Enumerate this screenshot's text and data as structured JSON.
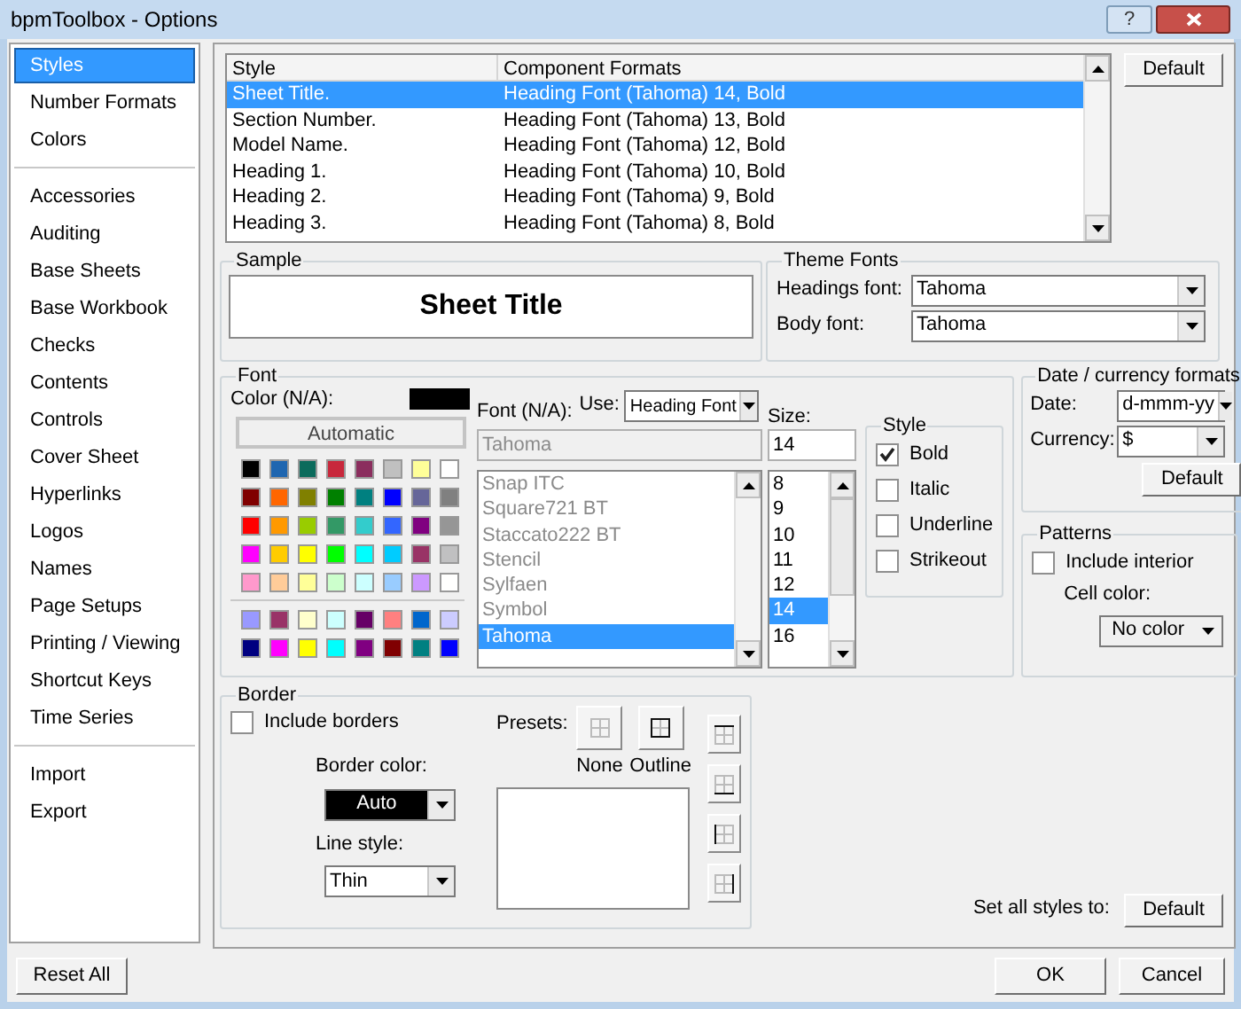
{
  "window": {
    "title": "bpmToolbox - Options",
    "help_button": "?"
  },
  "sidebar": {
    "groups": [
      {
        "items": [
          {
            "label": "Styles",
            "selected": true
          },
          {
            "label": "Number Formats",
            "selected": false
          },
          {
            "label": "Colors",
            "selected": false
          }
        ]
      },
      {
        "items": [
          {
            "label": "Accessories",
            "selected": false
          },
          {
            "label": "Auditing",
            "selected": false
          },
          {
            "label": "Base Sheets",
            "selected": false
          },
          {
            "label": "Base Workbook",
            "selected": false
          },
          {
            "label": "Checks",
            "selected": false
          },
          {
            "label": "Contents",
            "selected": false
          },
          {
            "label": "Controls",
            "selected": false
          },
          {
            "label": "Cover Sheet",
            "selected": false
          },
          {
            "label": "Hyperlinks",
            "selected": false
          },
          {
            "label": "Logos",
            "selected": false
          },
          {
            "label": "Names",
            "selected": false
          },
          {
            "label": "Page Setups",
            "selected": false
          },
          {
            "label": "Printing / Viewing",
            "selected": false
          },
          {
            "label": "Shortcut Keys",
            "selected": false
          },
          {
            "label": "Time Series",
            "selected": false
          }
        ]
      },
      {
        "items": [
          {
            "label": "Import",
            "selected": false
          },
          {
            "label": "Export",
            "selected": false
          }
        ]
      }
    ]
  },
  "styles_table": {
    "columns": [
      "Style",
      "Component Formats"
    ],
    "rows": [
      {
        "style": "Sheet Title.",
        "formats": "Heading Font (Tahoma) 14, Bold",
        "selected": true
      },
      {
        "style": "Section Number.",
        "formats": "Heading Font (Tahoma) 13, Bold",
        "selected": false
      },
      {
        "style": "Model Name.",
        "formats": "Heading Font (Tahoma) 12, Bold",
        "selected": false
      },
      {
        "style": "Heading 1.",
        "formats": "Heading Font (Tahoma) 10, Bold",
        "selected": false
      },
      {
        "style": "Heading 2.",
        "formats": "Heading Font (Tahoma) 9, Bold",
        "selected": false
      },
      {
        "style": "Heading 3.",
        "formats": "Heading Font (Tahoma) 8, Bold",
        "selected": false
      }
    ]
  },
  "default_button": "Default",
  "sample": {
    "title": "Sample",
    "text": "Sheet Title"
  },
  "theme_fonts": {
    "title": "Theme Fonts",
    "fields": [
      {
        "label": "Headings font:",
        "value": "Tahoma"
      },
      {
        "label": "Body font:",
        "value": "Tahoma"
      }
    ]
  },
  "font": {
    "title": "Font",
    "color_label": "Color (N/A):",
    "color_swatch": {
      "color": "#000000"
    },
    "automatic_button": "Automatic",
    "palette": [
      {
        "color": "#000000"
      },
      {
        "color": "#1f66b0"
      },
      {
        "color": "#0b6b5c"
      },
      {
        "color": "#c8283c"
      },
      {
        "color": "#8b2e5e"
      },
      {
        "color": "#c0c0c0"
      },
      {
        "color": "#ffff99"
      },
      {
        "color": "#ffffff"
      },
      {
        "color": "#800000"
      },
      {
        "color": "#ff6600"
      },
      {
        "color": "#808000"
      },
      {
        "color": "#008000"
      },
      {
        "color": "#008080"
      },
      {
        "color": "#0000ff"
      },
      {
        "color": "#666699"
      },
      {
        "color": "#808080"
      },
      {
        "color": "#ff0000"
      },
      {
        "color": "#ff9900"
      },
      {
        "color": "#99cc00"
      },
      {
        "color": "#339966"
      },
      {
        "color": "#33cccc"
      },
      {
        "color": "#3366ff"
      },
      {
        "color": "#800080"
      },
      {
        "color": "#969696"
      },
      {
        "color": "#ff00ff"
      },
      {
        "color": "#ffcc00"
      },
      {
        "color": "#ffff00"
      },
      {
        "color": "#00ff00"
      },
      {
        "color": "#00ffff"
      },
      {
        "color": "#00ccff"
      },
      {
        "color": "#993366"
      },
      {
        "color": "#c0c0c1"
      },
      {
        "color": "#ff99cc"
      },
      {
        "color": "#ffcc99"
      },
      {
        "color": "#ffff98"
      },
      {
        "color": "#ccffcc"
      },
      {
        "color": "#ccffff"
      },
      {
        "color": "#99ccff"
      },
      {
        "color": "#cc99ff"
      },
      {
        "color": "#fffffe"
      }
    ],
    "extra_palette": [
      {
        "color": "#9999ff"
      },
      {
        "color": "#993367"
      },
      {
        "color": "#ffffcc"
      },
      {
        "color": "#ccfffe"
      },
      {
        "color": "#660066"
      },
      {
        "color": "#ff8080"
      },
      {
        "color": "#0066cc"
      },
      {
        "color": "#ccccff"
      },
      {
        "color": "#000080"
      },
      {
        "color": "#ff00fe"
      },
      {
        "color": "#ffff01"
      },
      {
        "color": "#00fffe"
      },
      {
        "color": "#800081"
      },
      {
        "color": "#800001"
      },
      {
        "color": "#008081"
      },
      {
        "color": "#0000fe"
      }
    ],
    "font_label": "Font (N/A):",
    "use_label": "Use:",
    "use_value": "Heading Font",
    "size_label": "Size:",
    "font_name": "Tahoma",
    "size_value": "14",
    "fonts": [
      {
        "name": "Snap ITC",
        "selected": false
      },
      {
        "name": "Square721 BT",
        "selected": false
      },
      {
        "name": "Staccato222 BT",
        "selected": false
      },
      {
        "name": "Stencil",
        "selected": false
      },
      {
        "name": "Sylfaen",
        "selected": false
      },
      {
        "name": "Symbol",
        "selected": false
      },
      {
        "name": "Tahoma",
        "selected": true
      }
    ],
    "sizes": [
      {
        "value": "8",
        "selected": false
      },
      {
        "value": "9",
        "selected": false
      },
      {
        "value": "10",
        "selected": false
      },
      {
        "value": "11",
        "selected": false
      },
      {
        "value": "12",
        "selected": false
      },
      {
        "value": "14",
        "selected": true
      },
      {
        "value": "16",
        "selected": false
      }
    ],
    "style": {
      "title": "Style",
      "options": [
        {
          "label": "Bold",
          "checked": true
        },
        {
          "label": "Italic",
          "checked": false
        },
        {
          "label": "Underline",
          "checked": false
        },
        {
          "label": "Strikeout",
          "checked": false
        }
      ]
    }
  },
  "date_currency": {
    "title": "Date / currency formats",
    "fields": [
      {
        "label": "Date:",
        "value": "d-mmm-yy"
      },
      {
        "label": "Currency:",
        "value": "$"
      }
    ],
    "default_button": "Default"
  },
  "patterns": {
    "title": "Patterns",
    "include_interior": {
      "label": "Include interior",
      "checked": false
    },
    "cell_color_label": "Cell color:",
    "cell_color": "No color"
  },
  "border": {
    "title": "Border",
    "include_borders": {
      "label": "Include borders",
      "checked": false
    },
    "border_color_label": "Border color:",
    "border_color": "Auto",
    "line_style_label": "Line style:",
    "line_style": "Thin",
    "presets_label": "Presets:",
    "presets": [
      "None",
      "Outline"
    ]
  },
  "set_all": {
    "label": "Set all styles to:",
    "button": "Default"
  },
  "footer": {
    "reset_button": "Reset All",
    "ok_button": "OK",
    "cancel_button": "Cancel"
  }
}
